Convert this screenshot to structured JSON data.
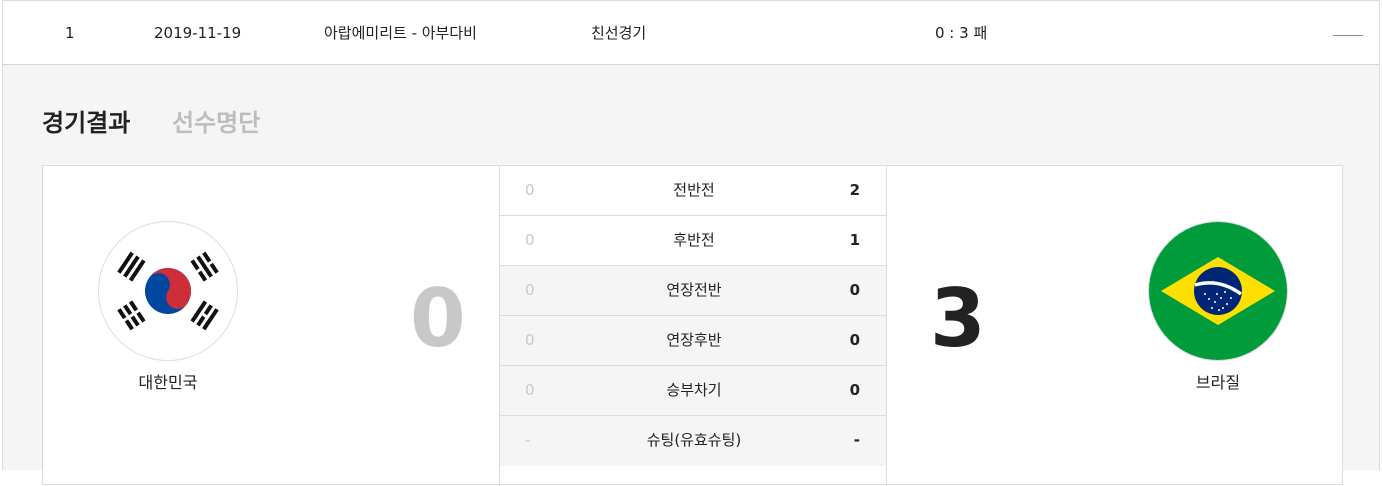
{
  "match_row": {
    "no": "1",
    "date": "2019-11-19",
    "venue": "아랍에미리트 - 아부다비",
    "type": "친선경기",
    "score": "0 : 3 패",
    "toggle_icon": "collapse-line-icon"
  },
  "tabs": [
    {
      "label": "경기결과",
      "active": true
    },
    {
      "label": "선수명단",
      "active": false
    }
  ],
  "home": {
    "name": "대한민국",
    "score": "0",
    "flag_icon": "korea-flag-icon",
    "colors": {
      "red": "#cd2e3a",
      "blue": "#0047a0"
    }
  },
  "away": {
    "name": "브라질",
    "score": "3",
    "flag_icon": "brazil-flag-icon",
    "colors": {
      "green": "#009c3b",
      "yellow": "#ffdf00",
      "blue": "#002776"
    }
  },
  "periods": [
    {
      "label": "전반전",
      "home": "0",
      "away": "2"
    },
    {
      "label": "후반전",
      "home": "0",
      "away": "1"
    },
    {
      "label": "연장전반",
      "home": "0",
      "away": "0"
    },
    {
      "label": "연장후반",
      "home": "0",
      "away": "0"
    },
    {
      "label": "승부차기",
      "home": "0",
      "away": "0"
    },
    {
      "label": "슈팅(유효슈팅)",
      "home": "-",
      "away": "-"
    }
  ]
}
